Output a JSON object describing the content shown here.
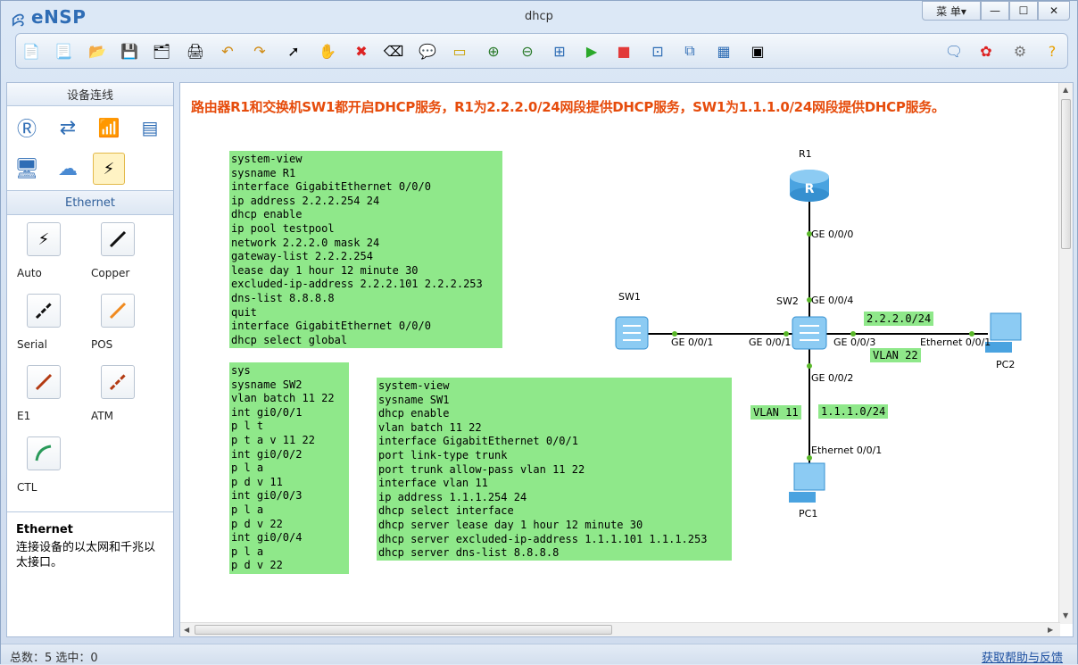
{
  "app": {
    "name": "eNSP",
    "title": "dhcp"
  },
  "window_controls": {
    "menu": "菜 单▾",
    "minimize": "—",
    "maximize": "☐",
    "close": "✕"
  },
  "left_panel": {
    "header": "设备连线",
    "ethernet_header": "Ethernet",
    "cables": [
      {
        "label": "Auto"
      },
      {
        "label": "Copper"
      },
      {
        "label": "Serial"
      },
      {
        "label": "POS"
      },
      {
        "label": "E1"
      },
      {
        "label": "ATM"
      },
      {
        "label": "CTL"
      }
    ],
    "info_title": "Ethernet",
    "info_desc": "连接设备的以太网和千兆以太接口。"
  },
  "canvas": {
    "headline": "路由器R1和交换机SW1都开启DHCP服务，R1为2.2.2.0/24网段提供DHCP服务，SW1为1.1.1.0/24网段提供DHCP服务。",
    "r1_config": "system-view\nsysname R1\ninterface GigabitEthernet 0/0/0\nip address 2.2.2.254 24\ndhcp enable\nip pool testpool\nnetwork 2.2.2.0 mask 24\ngateway-list 2.2.2.254\nlease day 1 hour 12 minute 30\nexcluded-ip-address 2.2.2.101 2.2.2.253\ndns-list 8.8.8.8\nquit\ninterface GigabitEthernet 0/0/0\ndhcp select global",
    "sw2_config": "sys\nsysname SW2\nvlan batch 11 22\nint gi0/0/1\np l t\np t a v 11 22\nint gi0/0/2\np l a\np d v 11\nint gi0/0/3\np l a\np d v 22\nint gi0/0/4\np l a\np d v 22",
    "sw1_config": "system-view\nsysname SW1\ndhcp enable\nvlan batch 11 22\ninterface GigabitEthernet 0/0/1\nport link-type trunk\nport trunk allow-pass vlan 11 22\ninterface vlan 11\nip address 1.1.1.254 24\ndhcp select interface\ndhcp server lease day 1 hour 12 minute 30\ndhcp server excluded-ip-address 1.1.1.101 1.1.1.253\ndhcp server dns-list 8.8.8.8",
    "topology": {
      "r1": "R1",
      "sw1": "SW1",
      "sw2": "SW2",
      "pc1": "PC1",
      "pc2": "PC2",
      "r1_port": "GE 0/0/0",
      "sw2_ge4": "GE 0/0/4",
      "sw1_port": "GE 0/0/1",
      "sw2_ge1": "GE 0/0/1",
      "sw2_ge3": "GE 0/0/3",
      "pc2_port": "Ethernet 0/0/1",
      "sw2_ge2": "GE 0/0/2",
      "pc1_port": "Ethernet 0/0/1",
      "net2": "2.2.2.0/24",
      "vlan22": "VLAN 22",
      "vlan11": "VLAN 11",
      "net1": "1.1.1.0/24"
    }
  },
  "status": {
    "left": "总数：5  选中：0",
    "right": "获取帮助与反馈"
  },
  "colors": {
    "accent": "#2f6db5",
    "headline": "#e64c0c",
    "config_bg": "#8fe88a",
    "link_dot": "#5ab82a"
  }
}
